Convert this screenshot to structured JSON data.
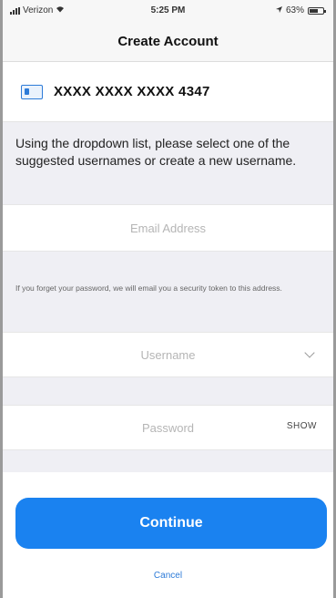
{
  "status_bar": {
    "carrier": "Verizon",
    "time": "5:25 PM",
    "battery": "63%",
    "battery_fraction": 0.63
  },
  "navbar": {
    "title": "Create Account"
  },
  "card": {
    "number": "XXXX XXXX XXXX 4347",
    "icon": "credit-card-icon"
  },
  "instruction": "Using the dropdown list, please select one of the suggested usernames or create a new username.",
  "form": {
    "email_placeholder": "Email Address",
    "email_hint": "If you forget your password, we will email you a security token to this address.",
    "username_placeholder": "Username",
    "password_placeholder": "Password",
    "show_label": "SHOW"
  },
  "actions": {
    "continue_label": "Continue",
    "cancel_label": "Cancel"
  },
  "colors": {
    "accent": "#1a82f0",
    "background_gray": "#efeff4"
  }
}
